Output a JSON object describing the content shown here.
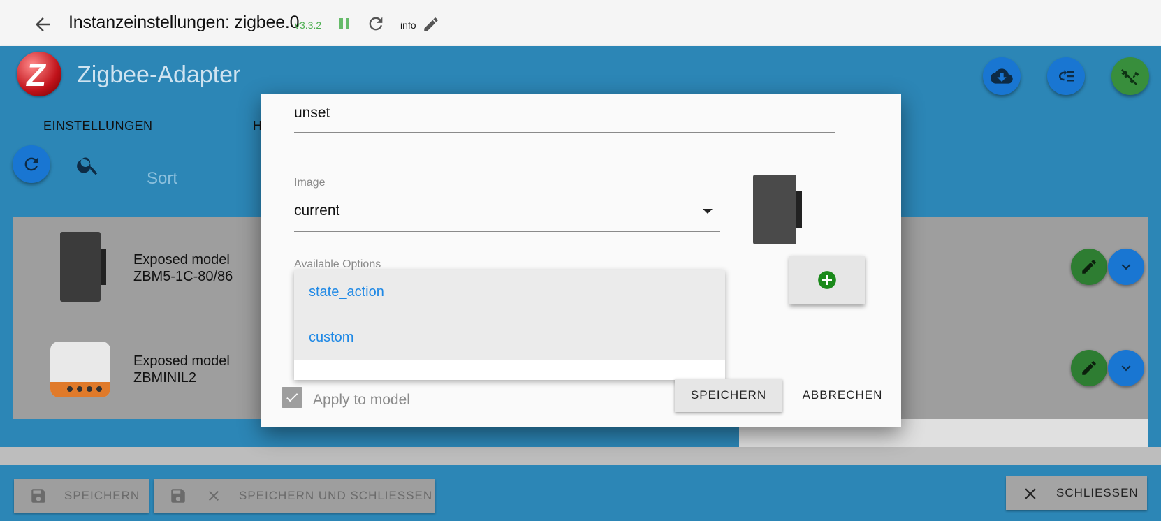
{
  "topbar": {
    "title": "Instanzeinstellungen:  zigbee.0",
    "version": "v3.3.2",
    "info_label": "info"
  },
  "app": {
    "logo_letter": "Z",
    "title": "Zigbee-Adapter",
    "tabs": [
      "EINSTELLUNGEN",
      "H"
    ],
    "sort_label": "Sort"
  },
  "devices": [
    {
      "label_line1": "Exposed model",
      "label_line2": "ZBM5-1C-80/86"
    },
    {
      "label_line1": "Exposed model",
      "label_line2": "ZBMINIL2"
    }
  ],
  "dialog": {
    "top_value": "unset",
    "image_label": "Image",
    "image_value": "current",
    "available_options_label": "Available Options",
    "options": [
      "state_action",
      "custom"
    ],
    "apply_label": "Apply to model",
    "apply_checked": true,
    "save_label": "SPEICHERN",
    "cancel_label": "ABBRECHEN"
  },
  "bottombar": {
    "save_label": "SPEICHERN",
    "save_close_label": "SPEICHERN UND SCHLIESSEN",
    "close_label": "SCHLIESSEN"
  },
  "colors": {
    "primary": "#2c86b6",
    "edit_green": "#2e7d32",
    "expand_blue": "#1976d2",
    "option_text": "#1e88e5",
    "version_green": "#4caf50"
  }
}
